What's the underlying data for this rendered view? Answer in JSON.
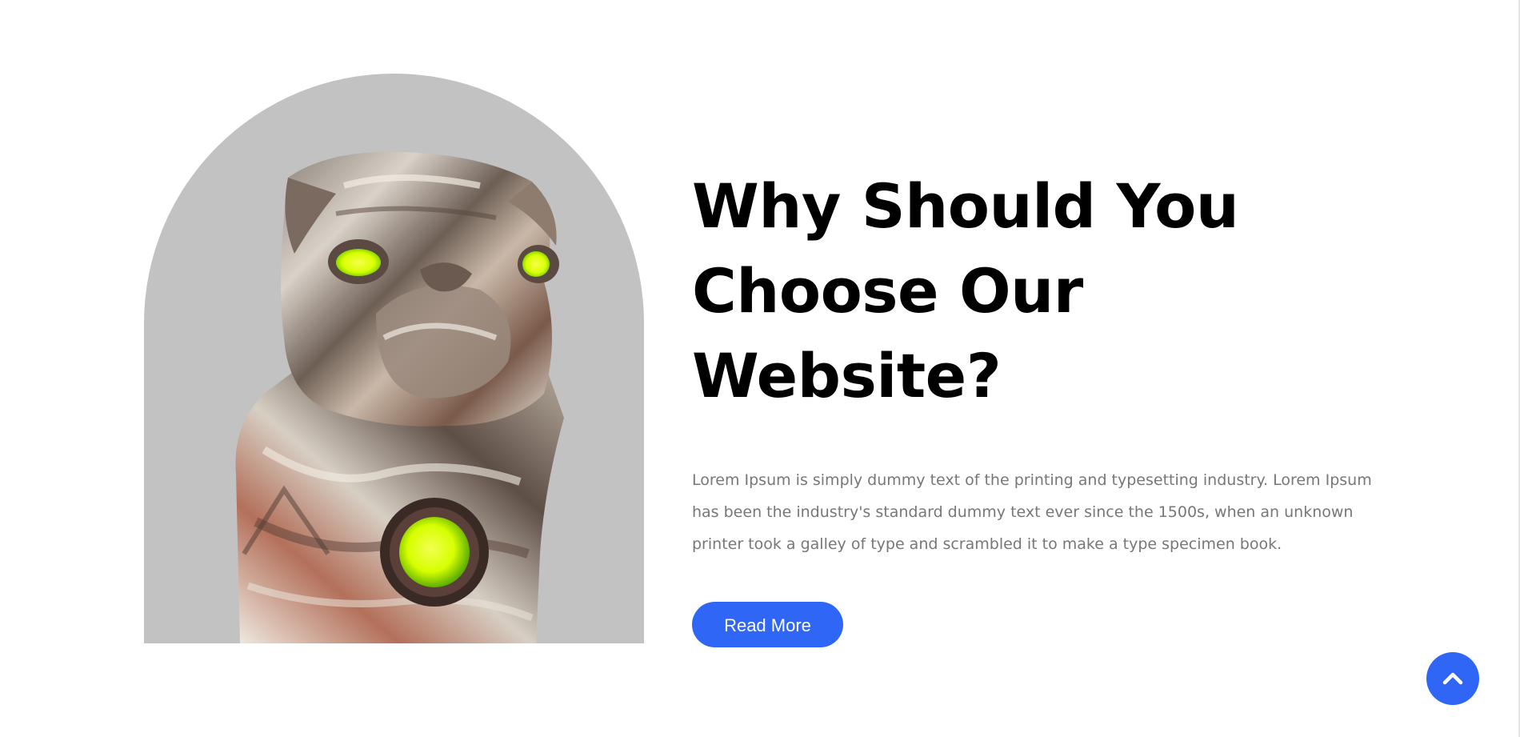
{
  "section": {
    "heading_line1": "Why Should You",
    "heading_line2": "Choose Our Website?",
    "description": "Lorem Ipsum is simply dummy text of the printing and typesetting industry. Lorem Ipsum has been the industry's standard dummy text ever since the 1500s, when an unknown printer took a galley of type and scrambled it to make a type specimen book.",
    "read_more_label": "Read More"
  },
  "image": {
    "subject": "chrome pug statue with glowing green eyes and pendant",
    "background_color": "#c2c2c2"
  },
  "scroll_to_top": {
    "icon": "chevron-up-icon"
  },
  "colors": {
    "accent": "#2f66f6",
    "heading": "#000000",
    "body_text": "#777777",
    "glow": "#e4ff10"
  }
}
